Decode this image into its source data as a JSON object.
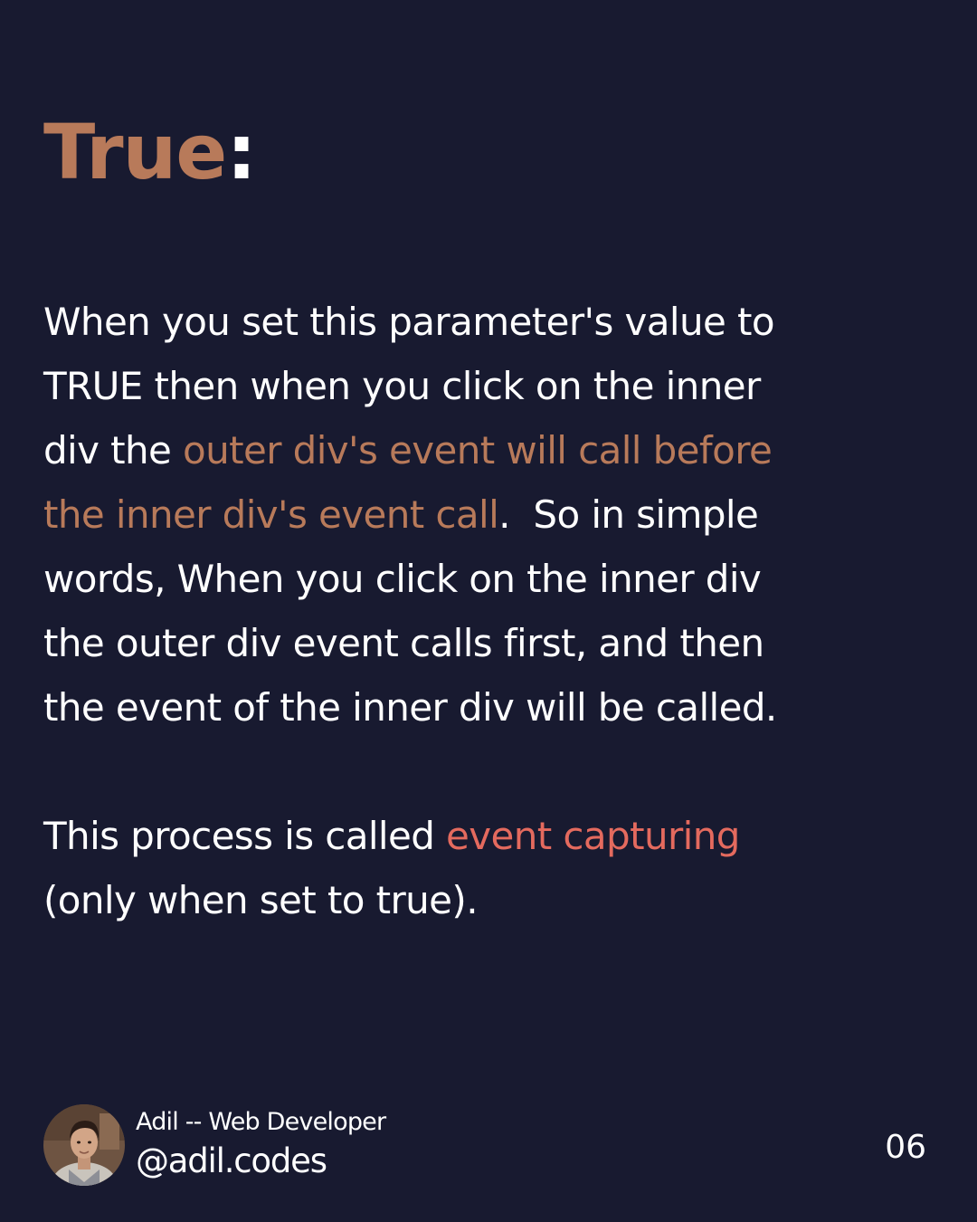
{
  "colors": {
    "background": "#181a30",
    "accent_brown": "#b87a5a",
    "accent_red": "#e46a5e",
    "text": "#ffffff"
  },
  "title": {
    "word": "True",
    "colon": ":"
  },
  "paragraph1": {
    "line1": "When you set this parameter's value to",
    "line2": "TRUE then when you click on the inner",
    "line3_plain": "div the ",
    "line3_highlight": "outer div's event will call before",
    "line4_highlight": "the inner div's event call",
    "line4_plain": ".  So in simple",
    "line5": "words, When you click on the inner div",
    "line6": "the outer div event calls first, and then",
    "line7": "the event of the inner div will be called."
  },
  "paragraph2": {
    "line1_plain": "This process is called ",
    "line1_highlight": "event capturing",
    "line2": "(only when set to true)."
  },
  "footer": {
    "author_name": "Adil -- Web Developer",
    "author_handle": "@adil.codes",
    "page_number": "06"
  },
  "icons": {
    "avatar": "profile-photo"
  }
}
